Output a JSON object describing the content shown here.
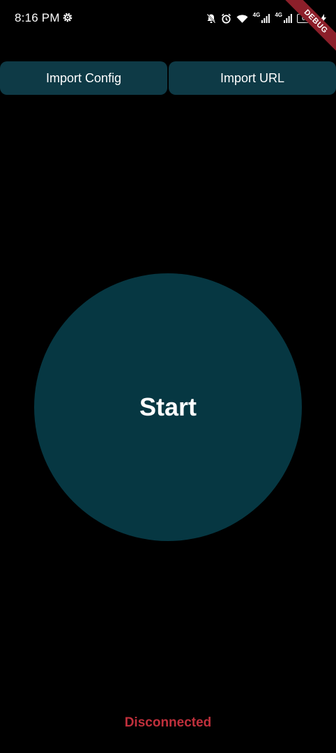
{
  "status_bar": {
    "time": "8:16 PM",
    "network_label_1": "4G",
    "network_label_2": "4G",
    "battery_level": "65",
    "icons": [
      "settings-gear-icon",
      "muted-bell-icon",
      "alarm-icon",
      "wifi-icon",
      "signal-icon",
      "battery-icon",
      "charging-icon"
    ]
  },
  "debug_banner": {
    "label": "DEBUG",
    "color": "#8c1f2a"
  },
  "actions": {
    "import_config_label": "Import Config",
    "import_url_label": "Import URL",
    "button_color": "#0e3a46"
  },
  "main": {
    "start_label": "Start",
    "circle_color": "#063742"
  },
  "connection": {
    "status_text": "Disconnected",
    "status_color": "#c0303c"
  }
}
